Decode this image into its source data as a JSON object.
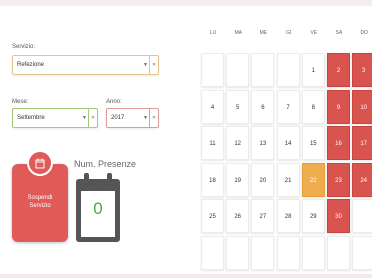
{
  "servizio": {
    "label": "Servizio:",
    "value": "Refezione"
  },
  "mese": {
    "label": "Mese:",
    "value": "Settembre"
  },
  "anno": {
    "label": "Anno:",
    "value": "2017"
  },
  "sospendi": {
    "label_line1": "Sospendi",
    "label_line2": "Servizio"
  },
  "presenze": {
    "title": "Num. Presenze",
    "count": "0"
  },
  "calendar": {
    "days": [
      "LU",
      "MA",
      "ME",
      "GI",
      "VE",
      "SA",
      "DO"
    ],
    "weeks": [
      [
        "",
        "",
        "",
        "",
        "1",
        "2",
        "3"
      ],
      [
        "4",
        "5",
        "6",
        "7",
        "8",
        "9",
        "10"
      ],
      [
        "11",
        "12",
        "13",
        "14",
        "15",
        "16",
        "17"
      ],
      [
        "18",
        "19",
        "20",
        "21",
        "22",
        "23",
        "24"
      ],
      [
        "25",
        "26",
        "27",
        "28",
        "29",
        "30",
        ""
      ],
      [
        "",
        "",
        "",
        "",
        "",
        "",
        ""
      ]
    ],
    "highlights": {
      "red": [
        "2",
        "3",
        "9",
        "10",
        "16",
        "17",
        "23",
        "24",
        "30"
      ],
      "orange": [
        "22"
      ]
    },
    "colors": {
      "red": "#d9534f",
      "orange": "#f0ad4e",
      "accent_green": "#4caa4a"
    }
  }
}
